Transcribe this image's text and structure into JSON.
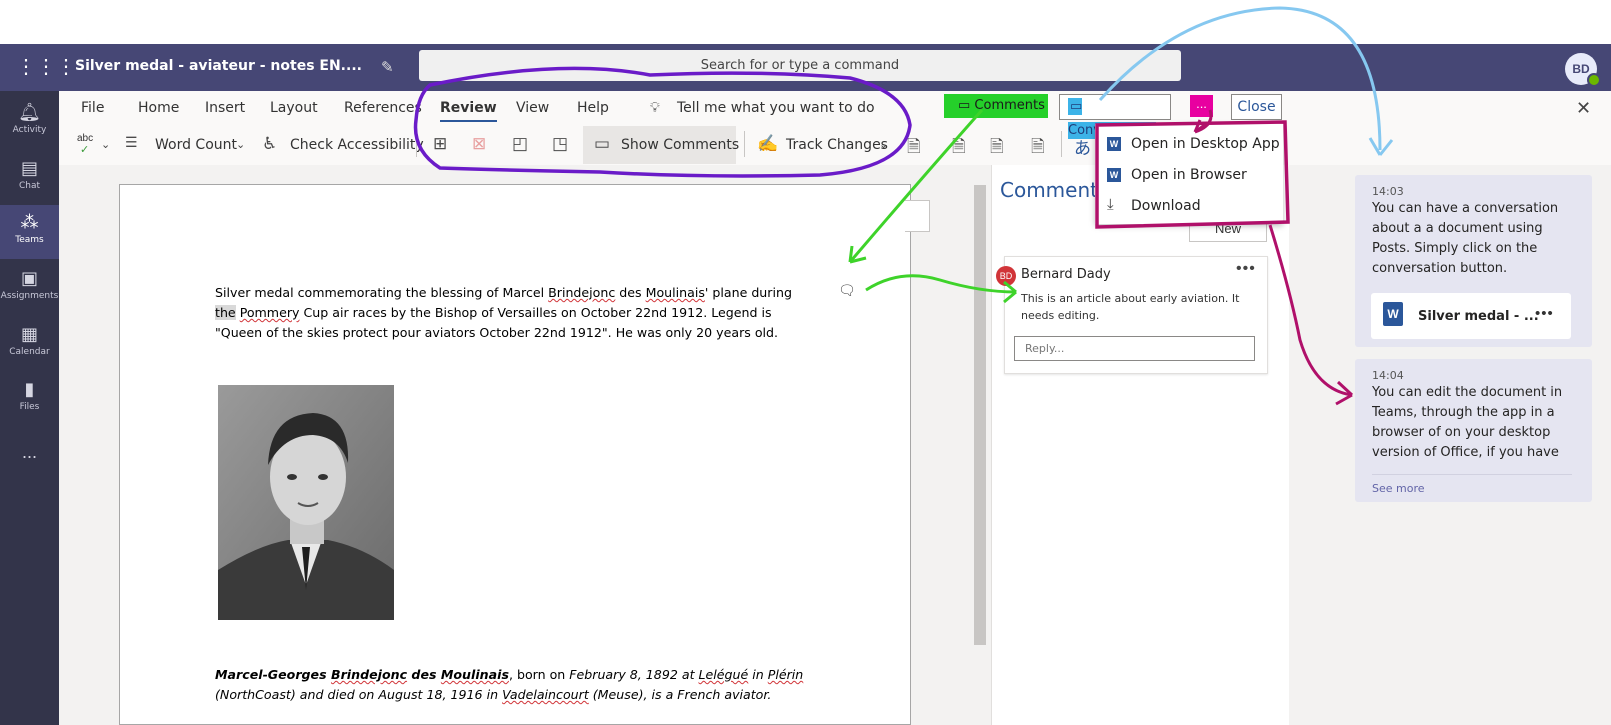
{
  "app": {
    "doc_title": "Silver medal - aviateur - notes EN....",
    "search_placeholder": "Search for or type a command",
    "avatar_initials": "BD"
  },
  "rail": {
    "items": [
      {
        "label": "Activity",
        "icon": "bell-icon"
      },
      {
        "label": "Chat",
        "icon": "chat-icon"
      },
      {
        "label": "Teams",
        "icon": "teams-icon",
        "active": true
      },
      {
        "label": "Assignments",
        "icon": "assignments-icon"
      },
      {
        "label": "Calendar",
        "icon": "calendar-icon"
      },
      {
        "label": "Files",
        "icon": "files-icon"
      }
    ],
    "more": "..."
  },
  "ribbon": {
    "tabs": [
      "File",
      "Home",
      "Insert",
      "Layout",
      "References",
      "Review",
      "View",
      "Help"
    ],
    "active_tab": "Review",
    "tell_me": "Tell me what you want to do",
    "tools": {
      "word_count": "Word Count",
      "check_accessibility": "Check Accessibility",
      "show_comments": "Show Comments",
      "track_changes": "Track Changes",
      "spelling_icon_label": "abc"
    }
  },
  "header_buttons": {
    "comments": "Comments",
    "conversation": "Conversation",
    "more": "...",
    "close": "Close"
  },
  "dropdown": {
    "items": [
      "Open in Desktop App",
      "Open in Browser",
      "Download"
    ]
  },
  "document": {
    "paragraph": {
      "p1": "Silver medal commemorating the blessing of Marcel ",
      "w1": "Brindejonc",
      "p2": " des ",
      "w2": "Moulinais",
      "p3": "' plane during ",
      "w3": "the",
      "p4": " ",
      "w4": "Pommery",
      "p5": " Cup air races by the Bishop of Versailles on October 22nd 1912. Legend is \"Queen of the skies protect pour aviators October 22nd 1912\". He was only 20 years old."
    },
    "caption": {
      "name_a": "Marcel-Georges ",
      "name_b": "Brindejonc",
      "name_c": "  des  ",
      "name_d": "Moulinais",
      "t1": ", born on ",
      "t2": "February 8,  1892 at  ",
      "t3": "Lelégué",
      "t4": "  in  ",
      "t5": "Plérin",
      "t6": " (NorthCoast)  and died on ",
      "t7": "August  18,  1916 in  ",
      "t8": "Vadelaincourt",
      "t9": "  (Meuse),  is  a  French aviator."
    }
  },
  "comments_pane": {
    "title": "Comments",
    "new_label": "New",
    "comment": {
      "initials": "BD",
      "author": "Bernard Dady",
      "text": "This is an article about early aviation. It needs editing.",
      "reply_placeholder": "Reply..."
    }
  },
  "conversation": {
    "posts": [
      {
        "time": "14:03",
        "text": "You can have a conversation about a a document using Posts. Simply click on the conversation button.",
        "attachment": "Silver medal - ..."
      },
      {
        "time": "14:04",
        "text": "You can edit the document in Teams, through the app in a browser of on your desktop version of Office, if you have",
        "see_more": "See more"
      }
    ]
  },
  "colors": {
    "teams_purple": "#464775",
    "rail": "#33344a",
    "word_blue": "#2b579a",
    "annotation_purple": "#6a1bc8",
    "annotation_green": "#3ed32a",
    "annotation_cyan": "#86c8f0",
    "annotation_magenta": "#b0106a"
  }
}
